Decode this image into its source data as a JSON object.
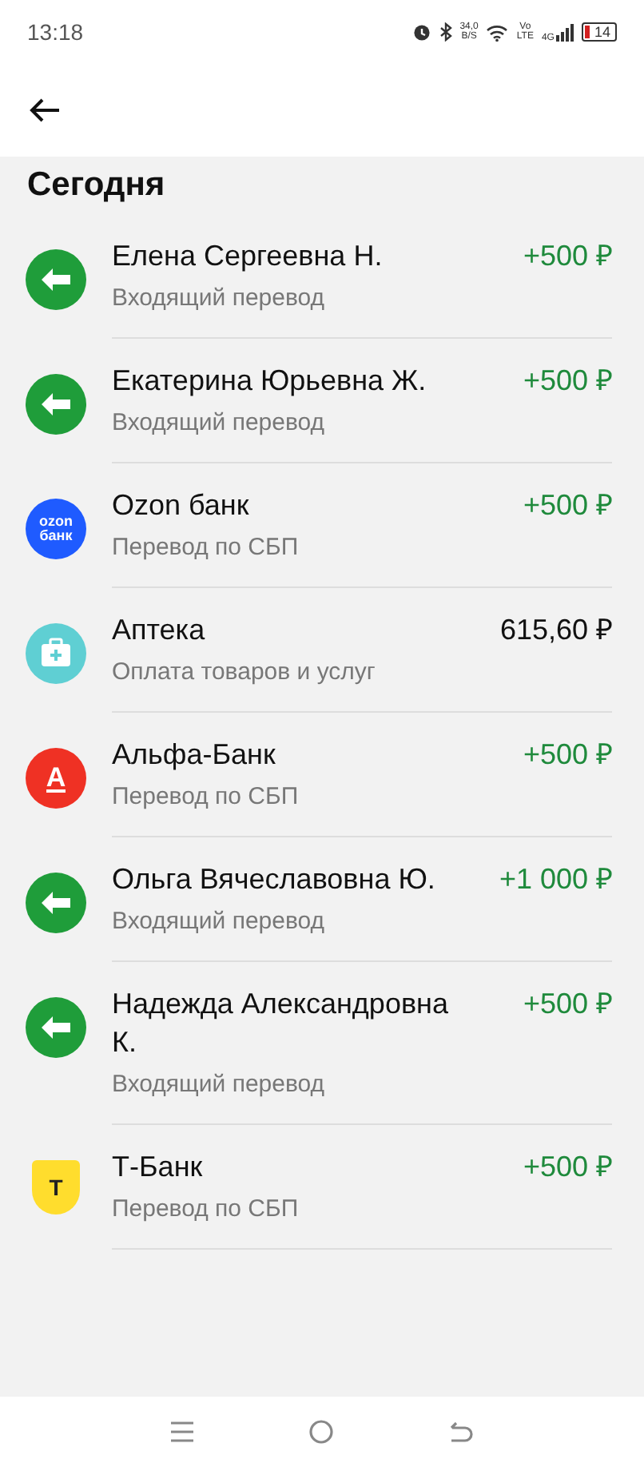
{
  "status_bar": {
    "time": "13:18",
    "speed": "34,0",
    "speed_unit": "B/S",
    "volte_top": "Vo",
    "volte_bottom": "LTE",
    "network": "4G",
    "battery": "14"
  },
  "section_title": "Сегодня",
  "transactions": [
    {
      "kind": "incoming",
      "name": "Елена Сергеевна Н.",
      "description": "Входящий перевод",
      "amount": "+500 ₽",
      "credit": true
    },
    {
      "kind": "incoming",
      "name": "Екатерина Юрьевна Ж.",
      "description": "Входящий перевод",
      "amount": "+500 ₽",
      "credit": true
    },
    {
      "kind": "ozon",
      "logo_text": [
        "ozon",
        "банк"
      ],
      "name": "Ozon банк",
      "description": "Перевод по СБП",
      "amount": "+500 ₽",
      "credit": true
    },
    {
      "kind": "pharmacy",
      "name": "Аптека",
      "description": "Оплата товаров и услуг",
      "amount": "615,60 ₽",
      "credit": false
    },
    {
      "kind": "alfa",
      "logo_text": [
        "А"
      ],
      "name": "Альфа-Банк",
      "description": "Перевод по СБП",
      "amount": "+500 ₽",
      "credit": true
    },
    {
      "kind": "incoming",
      "name": "Ольга Вячеславовна Ю.",
      "description": "Входящий перевод",
      "amount": "+1 000 ₽",
      "credit": true
    },
    {
      "kind": "incoming",
      "name": "Надежда Александровна К.",
      "description": "Входящий перевод",
      "amount": "+500 ₽",
      "credit": true
    },
    {
      "kind": "tbank",
      "logo_text": [
        "Т"
      ],
      "name": "Т-Банк",
      "description": "Перевод по СБП",
      "amount": "+500 ₽",
      "credit": true
    }
  ]
}
